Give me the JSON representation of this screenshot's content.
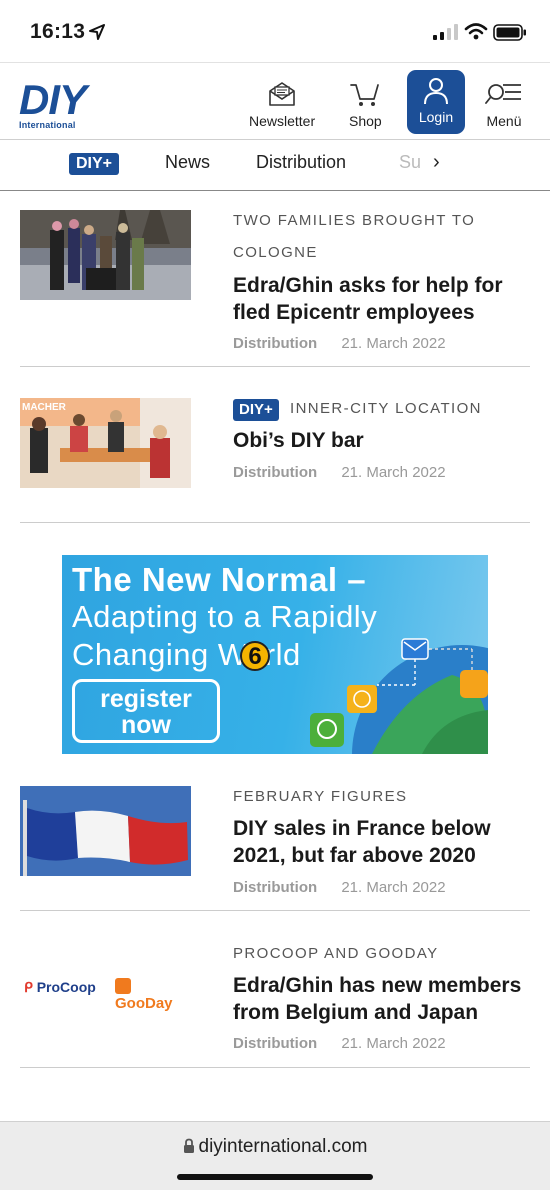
{
  "status": {
    "time": "16:13"
  },
  "header": {
    "logo_main": "DIY",
    "logo_sub": "International",
    "newsletter_label": "Newsletter",
    "shop_label": "Shop",
    "login_label": "Login",
    "menu_label": "Menü"
  },
  "categories": {
    "badge": "DIY+",
    "items": [
      "News",
      "Distribution",
      "Su"
    ]
  },
  "articles": [
    {
      "kicker_line1": "TWO FAMILIES BROUGHT TO",
      "kicker_line2": "COLOGNE",
      "title_line1": "Edra/Ghin asks for help for",
      "title_line2": "fled Epicentr employees",
      "category": "Distribution",
      "date": "21. March 2022"
    },
    {
      "badge": "DIY+",
      "kicker": "INNER-CITY LOCATION",
      "title": "Obi’s DIY bar",
      "category": "Distribution",
      "date": "21. March 2022"
    },
    {
      "kicker": "FEBRUARY FIGURES",
      "title_line1": "DIY sales in France below",
      "title_line2": "2021, but far above 2020",
      "category": "Distribution",
      "date": "21. March 2022"
    },
    {
      "kicker": "PROCOOP AND GOODAY",
      "title_line1": "Edra/Ghin has new members",
      "title_line2": "from Belgium and Japan",
      "category": "Distribution",
      "date": "21. March 2022",
      "logo_left": "ProCoop",
      "logo_right": "GooDay"
    }
  ],
  "ad": {
    "line1": "The New Normal –",
    "line2": "Adapting to a Rapidly",
    "line3": "Changing World",
    "button_line1": "register",
    "button_line2": "now",
    "badge": "6"
  },
  "urlbar": {
    "url": "diyinternational.com"
  },
  "colors": {
    "brand_blue": "#1c4f97",
    "ad_blue": "#36b1e8"
  }
}
